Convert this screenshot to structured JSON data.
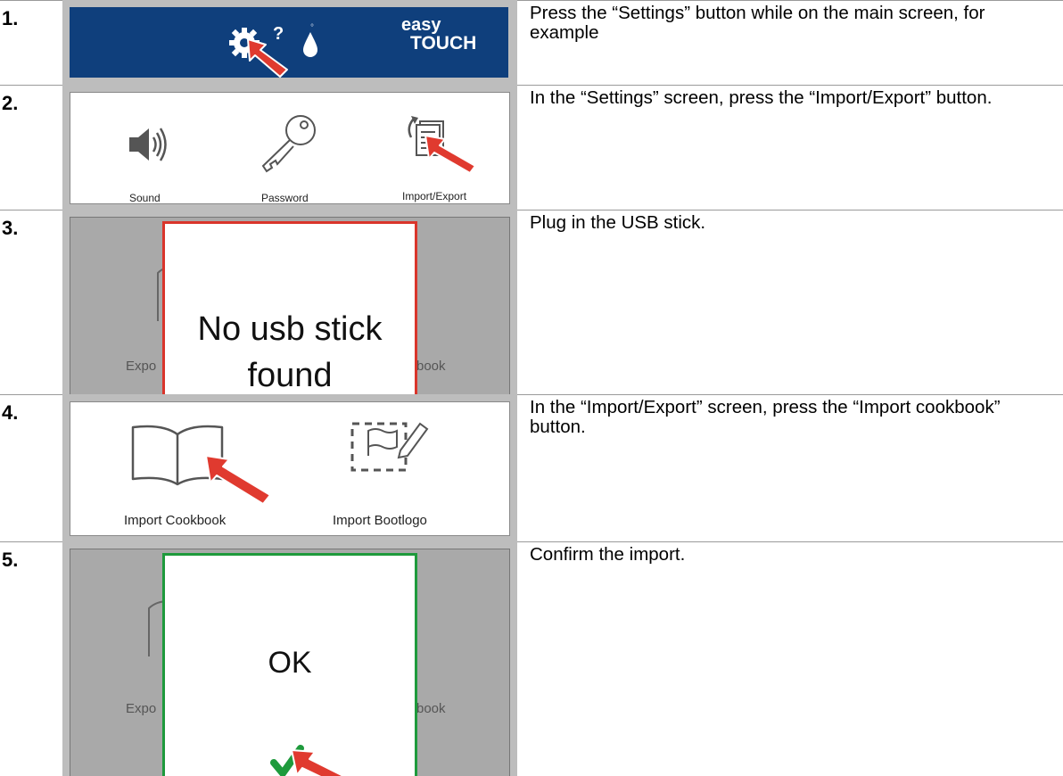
{
  "steps": [
    {
      "number": "1.",
      "description": "Press the “Settings” button while on the main screen, for example",
      "figure": {
        "brand_top": "easy",
        "brand_bottom": "TOUCH"
      }
    },
    {
      "number": "2.",
      "description": "In the “Settings” screen, press the “Import/Export” button.",
      "figure": {
        "labels": [
          "Sound",
          "Password",
          "Import/Export"
        ]
      }
    },
    {
      "number": "3.",
      "description": "Plug in the USB stick.",
      "figure": {
        "dialog_line1": "No usb stick",
        "dialog_line2": "found",
        "ghost_left": "Expo",
        "ghost_right": "book"
      }
    },
    {
      "number": "4.",
      "description": "In the “Import/Export” screen, press the “Import cookbook” button.",
      "figure": {
        "labels": [
          "Import Cookbook",
          "Import Bootlogo"
        ]
      }
    },
    {
      "number": "5.",
      "description": "Confirm the import.",
      "figure": {
        "dialog_text": "OK",
        "ghost_left": "Expo",
        "ghost_right": "book"
      }
    }
  ],
  "colors": {
    "banner": "#0f3f7c",
    "arrow": "#e03a2f",
    "error_border": "#d9352b",
    "ok_border": "#1e9a3c"
  },
  "icons": [
    "gear-icon",
    "help-icon",
    "water-drop-icon",
    "speaker-icon",
    "key-icon",
    "import-export-icon",
    "book-icon",
    "bootlogo-icon",
    "checkmark-icon",
    "pointer-arrow-icon"
  ]
}
